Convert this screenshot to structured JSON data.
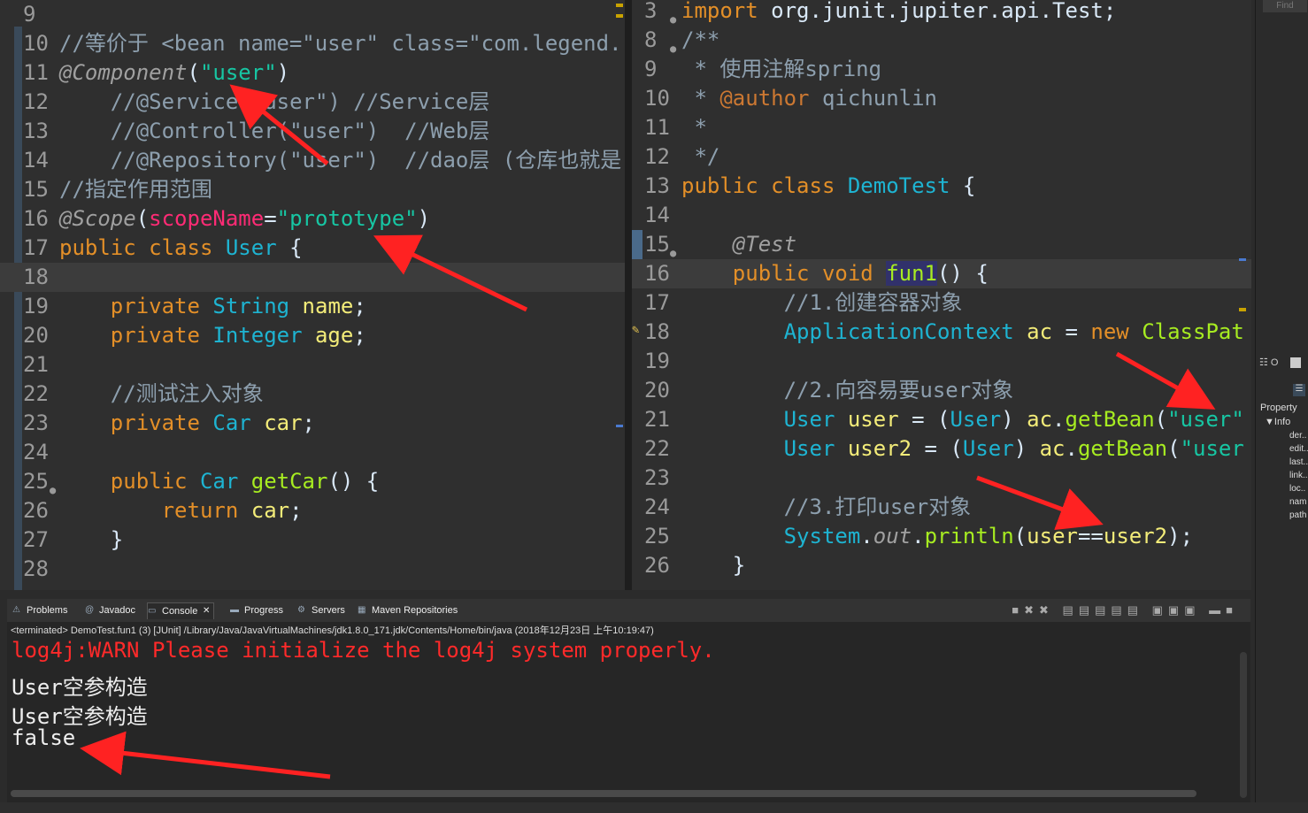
{
  "left_editor": {
    "lines": [
      {
        "n": "9",
        "parts": []
      },
      {
        "n": "10",
        "parts": [
          [
            "c",
            "//等价于 <bean name=\"user\" class=\"com.legend."
          ]
        ]
      },
      {
        "n": "11",
        "parts": [
          [
            "a",
            "@Component"
          ],
          [
            "pl",
            "("
          ],
          [
            "str",
            "\"user\""
          ],
          [
            "pl",
            ")"
          ]
        ]
      },
      {
        "n": "12",
        "parts": [
          [
            "c",
            "    //@Service(\"user\") //Service层"
          ]
        ]
      },
      {
        "n": "13",
        "parts": [
          [
            "c",
            "    //@Controller(\"user\")  //Web层"
          ]
        ]
      },
      {
        "n": "14",
        "parts": [
          [
            "c",
            "    //@Repository(\"user\")  //dao层 (仓库也就是"
          ]
        ]
      },
      {
        "n": "15",
        "parts": [
          [
            "c",
            "//指定作用范围"
          ]
        ]
      },
      {
        "n": "16",
        "parts": [
          [
            "a",
            "@Scope"
          ],
          [
            "pl",
            "("
          ],
          [
            "sn",
            "scopeName"
          ],
          [
            "pl",
            "="
          ],
          [
            "str",
            "\"prototype\""
          ],
          [
            "pl",
            ")"
          ]
        ]
      },
      {
        "n": "17",
        "parts": [
          [
            "k",
            "public class "
          ],
          [
            "t",
            "User"
          ],
          [
            "pl",
            " {"
          ]
        ]
      },
      {
        "n": "18",
        "parts": []
      },
      {
        "n": "19",
        "parts": [
          [
            "k",
            "    private "
          ],
          [
            "t",
            "String "
          ],
          [
            "v",
            "name"
          ],
          [
            "pl",
            ";"
          ]
        ]
      },
      {
        "n": "20",
        "parts": [
          [
            "k",
            "    private "
          ],
          [
            "t",
            "Integer "
          ],
          [
            "v",
            "age"
          ],
          [
            "pl",
            ";"
          ]
        ]
      },
      {
        "n": "21",
        "parts": []
      },
      {
        "n": "22",
        "parts": [
          [
            "c",
            "    //测试注入对象"
          ]
        ]
      },
      {
        "n": "23",
        "parts": [
          [
            "k",
            "    private "
          ],
          [
            "t",
            "Car "
          ],
          [
            "v",
            "car"
          ],
          [
            "pl",
            ";"
          ]
        ]
      },
      {
        "n": "24",
        "parts": []
      },
      {
        "n": "25",
        "parts": [
          [
            "k",
            "    public "
          ],
          [
            "t",
            "Car "
          ],
          [
            "f",
            "getCar"
          ],
          [
            "pl",
            "() {"
          ]
        ]
      },
      {
        "n": "26",
        "parts": [
          [
            "k",
            "        return "
          ],
          [
            "v",
            "car"
          ],
          [
            "pl",
            ";"
          ]
        ]
      },
      {
        "n": "27",
        "parts": [
          [
            "pl",
            "    }"
          ]
        ]
      },
      {
        "n": "28",
        "parts": []
      }
    ]
  },
  "right_editor": {
    "lines": [
      {
        "n": "3",
        "parts": [
          [
            "k",
            "import "
          ],
          [
            "pl",
            "org.junit.jupiter.api.Test;"
          ]
        ]
      },
      {
        "n": "8",
        "parts": [
          [
            "c",
            "/**"
          ]
        ]
      },
      {
        "n": "9",
        "parts": [
          [
            "c",
            " * 使用注解spring"
          ]
        ]
      },
      {
        "n": "10",
        "parts": [
          [
            "c",
            " * "
          ],
          [
            "k2",
            "@author"
          ],
          [
            "c",
            " qichunlin"
          ]
        ]
      },
      {
        "n": "11",
        "parts": [
          [
            "c",
            " *"
          ]
        ]
      },
      {
        "n": "12",
        "parts": [
          [
            "c",
            " */"
          ]
        ]
      },
      {
        "n": "13",
        "parts": [
          [
            "k",
            "public class "
          ],
          [
            "t",
            "DemoTest"
          ],
          [
            "pl",
            " {"
          ]
        ]
      },
      {
        "n": "14",
        "parts": []
      },
      {
        "n": "15",
        "parts": [
          [
            "a",
            "    @Test"
          ]
        ]
      },
      {
        "n": "16",
        "parts": [
          [
            "k",
            "    public void "
          ],
          [
            "fnhl",
            "fun1"
          ],
          [
            "pl",
            "() {"
          ]
        ]
      },
      {
        "n": "17",
        "parts": [
          [
            "c",
            "        //1.创建容器对象"
          ]
        ]
      },
      {
        "n": "18",
        "parts": [
          [
            "t",
            "        ApplicationContext "
          ],
          [
            "v",
            "ac"
          ],
          [
            "pl",
            " = "
          ],
          [
            "k",
            "new "
          ],
          [
            "f",
            "ClassPat"
          ]
        ]
      },
      {
        "n": "19",
        "parts": []
      },
      {
        "n": "20",
        "parts": [
          [
            "c",
            "        //2.向容易要user对象"
          ]
        ]
      },
      {
        "n": "21",
        "parts": [
          [
            "t",
            "        User "
          ],
          [
            "v",
            "user"
          ],
          [
            "pl",
            " = ("
          ],
          [
            "t",
            "User"
          ],
          [
            "pl",
            ") "
          ],
          [
            "v",
            "ac"
          ],
          [
            "pl",
            "."
          ],
          [
            "f",
            "getBean"
          ],
          [
            "pl",
            "("
          ],
          [
            "str",
            "\"user\""
          ]
        ]
      },
      {
        "n": "22",
        "parts": [
          [
            "t",
            "        User "
          ],
          [
            "v",
            "user2"
          ],
          [
            "pl",
            " = ("
          ],
          [
            "t",
            "User"
          ],
          [
            "pl",
            ") "
          ],
          [
            "v",
            "ac"
          ],
          [
            "pl",
            "."
          ],
          [
            "f",
            "getBean"
          ],
          [
            "pl",
            "("
          ],
          [
            "str",
            "\"user"
          ]
        ]
      },
      {
        "n": "23",
        "parts": []
      },
      {
        "n": "24",
        "parts": [
          [
            "c",
            "        //3.打印user对象"
          ]
        ]
      },
      {
        "n": "25",
        "parts": [
          [
            "t",
            "        System"
          ],
          [
            "pl",
            "."
          ],
          [
            "a",
            "out"
          ],
          [
            "pl",
            "."
          ],
          [
            "f",
            "println"
          ],
          [
            "pl",
            "("
          ],
          [
            "v",
            "user"
          ],
          [
            "pl",
            "=="
          ],
          [
            "v",
            "user2"
          ],
          [
            "pl",
            ");"
          ]
        ]
      },
      {
        "n": "26",
        "parts": [
          [
            "pl",
            "    }"
          ]
        ]
      }
    ]
  },
  "console": {
    "tabs": [
      {
        "label": "Problems",
        "icon": "problems-icon",
        "glyph": "⚠"
      },
      {
        "label": "Javadoc",
        "icon": "javadoc-icon",
        "glyph": "@"
      },
      {
        "label": "Console",
        "icon": "console-icon",
        "glyph": "▭",
        "active": true
      },
      {
        "label": "Progress",
        "icon": "progress-icon",
        "glyph": "▬"
      },
      {
        "label": "Servers",
        "icon": "servers-icon",
        "glyph": "⚙"
      },
      {
        "label": "Maven Repositories",
        "icon": "maven-icon",
        "glyph": "▦"
      }
    ],
    "close_glyph": "✕",
    "terminated": "<terminated> DemoTest.fun1 (3) [JUnit] /Library/Java/JavaVirtualMachines/jdk1.8.0_171.jdk/Contents/Home/bin/java (2018年12月23日 上午10:19:47)",
    "output": [
      {
        "text": "log4j:WARN Please initialize the log4j system properly.",
        "kind": "warn"
      },
      {
        "text": "User空参构造",
        "kind": "norm"
      },
      {
        "text": "User空参构造",
        "kind": "norm"
      },
      {
        "text": "false",
        "kind": "norm"
      }
    ]
  },
  "side_panel": {
    "find_label": "Find",
    "outline_label": "O",
    "property_label": "Property",
    "info_label": "Info",
    "items": [
      "der..",
      "edit..",
      "last..",
      "link..",
      "loc..",
      "nam",
      "path"
    ]
  }
}
